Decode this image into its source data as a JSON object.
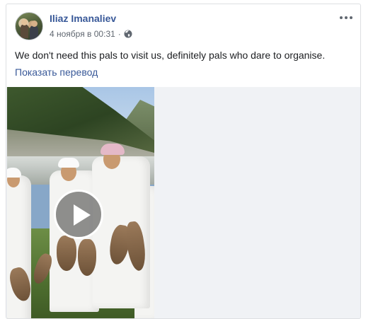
{
  "post": {
    "author": "Iliaz Imanaliev",
    "timestamp": "4 ноября в 00:31",
    "separator": "·",
    "audience_icon": "globe-icon",
    "more_icon": "more-options-icon",
    "text": "We don't need this pals to visit us, definitely pals who dare to organise.",
    "translate_link": "Показать перевод"
  },
  "media": {
    "type": "video",
    "play_icon": "play-icon"
  },
  "colors": {
    "link_blue": "#385898",
    "meta_gray": "#606770",
    "text_dark": "#1c1e21",
    "border": "#dddfe2"
  }
}
